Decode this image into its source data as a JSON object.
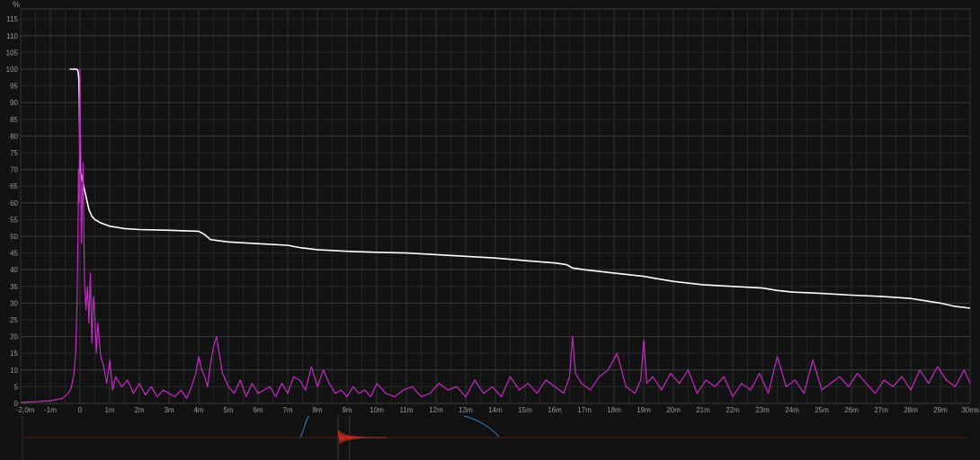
{
  "chart_data": {
    "type": "line",
    "title": "",
    "y_unit_label": "%",
    "xlabel": "",
    "ylabel": "",
    "xlim": [
      -2.0,
      30.0
    ],
    "ylim": [
      0,
      118
    ],
    "grid": true,
    "colors": {
      "background": "#121212",
      "grid": "#2f2f2f",
      "schroeder_line": "#ffffff",
      "energy_line": "#c429c4",
      "overview_waveform": "#d22a1f",
      "overview_window": "#3a7fc1"
    },
    "y_ticks": [
      "0",
      "5",
      "10",
      "15",
      "20",
      "25",
      "30",
      "35",
      "40",
      "45",
      "50",
      "55",
      "60",
      "65",
      "70",
      "75",
      "80",
      "85",
      "90",
      "95",
      "100",
      "105",
      "110",
      "115"
    ],
    "x_ticks": [
      {
        "v": -2,
        "label": "-2,0m"
      },
      {
        "v": -1,
        "label": "-1m"
      },
      {
        "v": 0,
        "label": "0"
      },
      {
        "v": 1,
        "label": "1m"
      },
      {
        "v": 2,
        "label": "2m"
      },
      {
        "v": 3,
        "label": "3m"
      },
      {
        "v": 4,
        "label": "4m"
      },
      {
        "v": 5,
        "label": "5m"
      },
      {
        "v": 6,
        "label": "6m"
      },
      {
        "v": 7,
        "label": "7m"
      },
      {
        "v": 8,
        "label": "8m"
      },
      {
        "v": 9,
        "label": "9m"
      },
      {
        "v": 10,
        "label": "10m"
      },
      {
        "v": 11,
        "label": "11m"
      },
      {
        "v": 12,
        "label": "12m"
      },
      {
        "v": 13,
        "label": "13m"
      },
      {
        "v": 14,
        "label": "14m"
      },
      {
        "v": 15,
        "label": "15m"
      },
      {
        "v": 16,
        "label": "16m"
      },
      {
        "v": 17,
        "label": "17m"
      },
      {
        "v": 18,
        "label": "18m"
      },
      {
        "v": 19,
        "label": "19m"
      },
      {
        "v": 20,
        "label": "20m"
      },
      {
        "v": 21,
        "label": "21m"
      },
      {
        "v": 22,
        "label": "22m"
      },
      {
        "v": 23,
        "label": "23m"
      },
      {
        "v": 24,
        "label": "24m"
      },
      {
        "v": 25,
        "label": "25m"
      },
      {
        "v": 26,
        "label": "26m"
      },
      {
        "v": 27,
        "label": "27m"
      },
      {
        "v": 28,
        "label": "28m"
      },
      {
        "v": 29,
        "label": "29m"
      },
      {
        "v": 30,
        "label": "30ms"
      }
    ],
    "series": [
      {
        "key": "schroeder",
        "x": [
          -0.35,
          -0.15,
          -0.1,
          -0.08,
          -0.06,
          -0.04,
          -0.02,
          0.0,
          0.05,
          0.1,
          0.2,
          0.3,
          0.4,
          0.5,
          0.7,
          1.0,
          1.5,
          2.0,
          3.0,
          4.0,
          4.2,
          4.4,
          5.0,
          6.0,
          7.0,
          7.4,
          8.0,
          9.0,
          10.0,
          11.0,
          12.0,
          13.0,
          14.0,
          15.0,
          16.0,
          16.4,
          16.6,
          17.0,
          18.0,
          19.0,
          19.4,
          20.0,
          21.0,
          22.0,
          23.0,
          23.5,
          24.0,
          25.0,
          26.0,
          27.0,
          28.0,
          29.0,
          29.5,
          30.0
        ],
        "values": [
          100,
          100,
          99.9,
          99.7,
          99,
          97,
          90,
          70,
          68,
          66,
          62,
          58,
          56,
          55,
          54,
          53,
          52.3,
          52,
          51.8,
          51.5,
          50.5,
          49,
          48.3,
          47.8,
          47.3,
          46.6,
          46,
          45.5,
          45.2,
          45,
          44.5,
          44,
          43.5,
          42.7,
          42,
          41.5,
          40.5,
          40,
          39,
          38,
          37.4,
          36.5,
          35.5,
          35,
          34.5,
          33.8,
          33.3,
          32.9,
          32.4,
          32,
          31.4,
          30,
          29,
          28.5
        ]
      },
      {
        "key": "energy",
        "x": [
          -2.0,
          -1.5,
          -1.0,
          -0.6,
          -0.4,
          -0.3,
          -0.2,
          -0.15,
          -0.1,
          -0.07,
          -0.05,
          -0.03,
          0.0,
          0.05,
          0.1,
          0.15,
          0.2,
          0.25,
          0.3,
          0.35,
          0.4,
          0.45,
          0.5,
          0.55,
          0.6,
          0.7,
          0.8,
          0.9,
          1.0,
          1.1,
          1.2,
          1.4,
          1.6,
          1.8,
          2.0,
          2.2,
          2.4,
          2.6,
          2.8,
          3.0,
          3.2,
          3.4,
          3.6,
          3.8,
          3.9,
          4.0,
          4.1,
          4.2,
          4.3,
          4.4,
          4.5,
          4.6,
          4.8,
          5.0,
          5.2,
          5.4,
          5.6,
          5.8,
          6.0,
          6.2,
          6.4,
          6.6,
          6.8,
          7.0,
          7.2,
          7.4,
          7.6,
          7.8,
          8.0,
          8.2,
          8.4,
          8.6,
          8.8,
          9.0,
          9.2,
          9.4,
          9.6,
          9.8,
          10.0,
          10.3,
          10.6,
          10.9,
          11.2,
          11.5,
          11.8,
          12.1,
          12.4,
          12.7,
          13.0,
          13.3,
          13.6,
          13.9,
          14.2,
          14.5,
          14.8,
          15.1,
          15.4,
          15.7,
          16.0,
          16.3,
          16.5,
          16.6,
          16.7,
          16.9,
          17.2,
          17.5,
          17.8,
          18.1,
          18.4,
          18.7,
          18.9,
          19.0,
          19.1,
          19.3,
          19.6,
          19.9,
          20.2,
          20.5,
          20.8,
          21.1,
          21.4,
          21.7,
          22.0,
          22.3,
          22.6,
          22.9,
          23.2,
          23.5,
          23.8,
          24.1,
          24.4,
          24.7,
          25.0,
          25.3,
          25.6,
          25.9,
          26.2,
          26.5,
          26.8,
          27.1,
          27.4,
          27.7,
          28.0,
          28.3,
          28.6,
          28.9,
          29.2,
          29.5,
          29.8,
          30.0
        ],
        "values": [
          0.3,
          0.5,
          0.8,
          1.5,
          3,
          4.5,
          9,
          15,
          30,
          50,
          70,
          60,
          100,
          48,
          72,
          36,
          28,
          35,
          24,
          39,
          18,
          32,
          26,
          15,
          24,
          14,
          11,
          6,
          13,
          4,
          8,
          5,
          7,
          3,
          6,
          2.5,
          5,
          2,
          4,
          3,
          2,
          4,
          1.5,
          6,
          9,
          14,
          10,
          8,
          5,
          12,
          17,
          20,
          9,
          5,
          3,
          7,
          2,
          6,
          3,
          4,
          5,
          2,
          6,
          3,
          8,
          7,
          4,
          11,
          5,
          10,
          6,
          3,
          4,
          2,
          5,
          3,
          4,
          2,
          6,
          3,
          2,
          4,
          5,
          2,
          3,
          6,
          4,
          5,
          2,
          7,
          3,
          5,
          2,
          8,
          4,
          6,
          3,
          7,
          5,
          3,
          8,
          20,
          9,
          6,
          4,
          8,
          10,
          15,
          5,
          3,
          7,
          19,
          6,
          8,
          4,
          9,
          6,
          10,
          3,
          7,
          5,
          8,
          2,
          6,
          4,
          9,
          3,
          14,
          5,
          7,
          3,
          13,
          4,
          6,
          8,
          5,
          9,
          6,
          3,
          7,
          5,
          8,
          4,
          10,
          6,
          11,
          7,
          5,
          10,
          6
        ]
      }
    ]
  }
}
